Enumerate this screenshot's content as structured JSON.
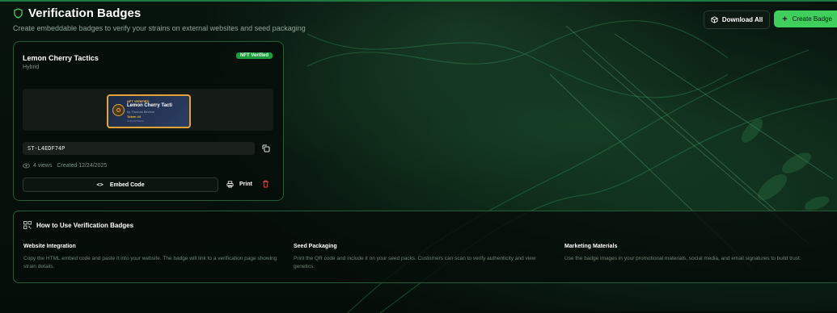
{
  "header": {
    "title": "Verification Badges",
    "subtitle": "Create embeddable badges to verify your strains on external websites and seed packaging",
    "download_all_label": "Download All",
    "create_badge_label": "Create Badge"
  },
  "badge_card": {
    "strain_name": "Lemon Cherry Tactics",
    "strain_type": "Hybrid",
    "status_badge": "NFT Verified",
    "preview": {
      "kicker": "NFT VERIFIED",
      "name": "Lemon Cherry Tacti",
      "breeder": "by Thomas Bevlom",
      "token": "Token #4",
      "foot": "STRAINTRACK"
    },
    "code": "ST-L4EDF74P",
    "views": "4 views",
    "created": "Created 12/24/2025",
    "embed_label": "Embed Code",
    "print_label": "Print"
  },
  "how_to": {
    "title": "How to Use Verification Badges",
    "columns": [
      {
        "title": "Website Integration",
        "desc": "Copy the HTML embed code and paste it into your website. The badge will link to a verification page showing strain details."
      },
      {
        "title": "Seed Packaging",
        "desc": "Print the QR code and include it on your seed packs. Customers can scan to verify authenticity and view genetics."
      },
      {
        "title": "Marketing Materials",
        "desc": "Use the badge images in your promotional materials, social media, and email signatures to build trust."
      }
    ]
  },
  "colors": {
    "accent": "#3ecf5c",
    "nft_badge": "#1f9a3f",
    "gold": "#e3a33a",
    "danger": "#e04848"
  },
  "icons": {
    "title": "shield-icon",
    "download": "package-icon",
    "create": "plus-icon",
    "copy": "copy-icon",
    "views": "eye-icon",
    "embed": "code-icon",
    "print": "printer-icon",
    "delete": "trash-icon",
    "how_to": "qr-code-icon"
  }
}
